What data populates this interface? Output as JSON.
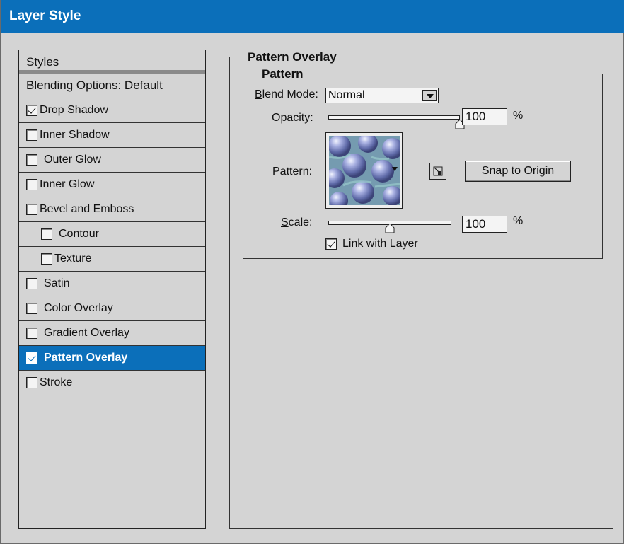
{
  "window": {
    "title": "Layer Style"
  },
  "styles_panel": {
    "header": "Styles",
    "items": [
      {
        "label": "Blending Options: Default",
        "checkbox": false,
        "checked": false,
        "indent": false,
        "selected": false
      },
      {
        "label": "Drop Shadow",
        "checkbox": true,
        "checked": true,
        "indent": false,
        "selected": false
      },
      {
        "label": "Inner Shadow",
        "checkbox": true,
        "checked": false,
        "indent": false,
        "selected": false
      },
      {
        "label": "Outer Glow",
        "checkbox": true,
        "checked": false,
        "indent": false,
        "selected": false
      },
      {
        "label": "Inner Glow",
        "checkbox": true,
        "checked": false,
        "indent": false,
        "selected": false
      },
      {
        "label": "Bevel and Emboss",
        "checkbox": true,
        "checked": false,
        "indent": false,
        "selected": false
      },
      {
        "label": "Contour",
        "checkbox": true,
        "checked": false,
        "indent": true,
        "selected": false
      },
      {
        "label": "Texture",
        "checkbox": true,
        "checked": false,
        "indent": true,
        "selected": false
      },
      {
        "label": "Satin",
        "checkbox": true,
        "checked": false,
        "indent": false,
        "selected": false
      },
      {
        "label": "Color Overlay",
        "checkbox": true,
        "checked": false,
        "indent": false,
        "selected": false
      },
      {
        "label": "Gradient Overlay",
        "checkbox": true,
        "checked": false,
        "indent": false,
        "selected": false
      },
      {
        "label": "Pattern Overlay",
        "checkbox": true,
        "checked": true,
        "indent": false,
        "selected": true
      },
      {
        "label": "Stroke",
        "checkbox": true,
        "checked": false,
        "indent": false,
        "selected": false
      }
    ]
  },
  "pattern_overlay": {
    "section_title": "Pattern Overlay",
    "group_title": "Pattern",
    "blend_mode": {
      "label_prefix": "B",
      "label_rest": "lend Mode:",
      "value": "Normal"
    },
    "opacity": {
      "label_prefix": "O",
      "label_rest": "pacity:",
      "value": "100",
      "unit": "%",
      "level_percent": 100
    },
    "pattern": {
      "label": "Pattern:",
      "icon": "new-preset-icon"
    },
    "snap_button": {
      "pre": "Sn",
      "underlined": "a",
      "post": "p to Origin"
    },
    "scale": {
      "label_prefix": "S",
      "label_rest": "cale:",
      "value": "100",
      "unit": "%",
      "level_percent": 50
    },
    "link_with_layer": {
      "pre": "Lin",
      "underlined": "k",
      "post": " with Layer",
      "checked": true
    }
  },
  "colors": {
    "titlebar": "#0b6fba",
    "selected": "#0b6fba",
    "background": "#d4d4d4"
  }
}
